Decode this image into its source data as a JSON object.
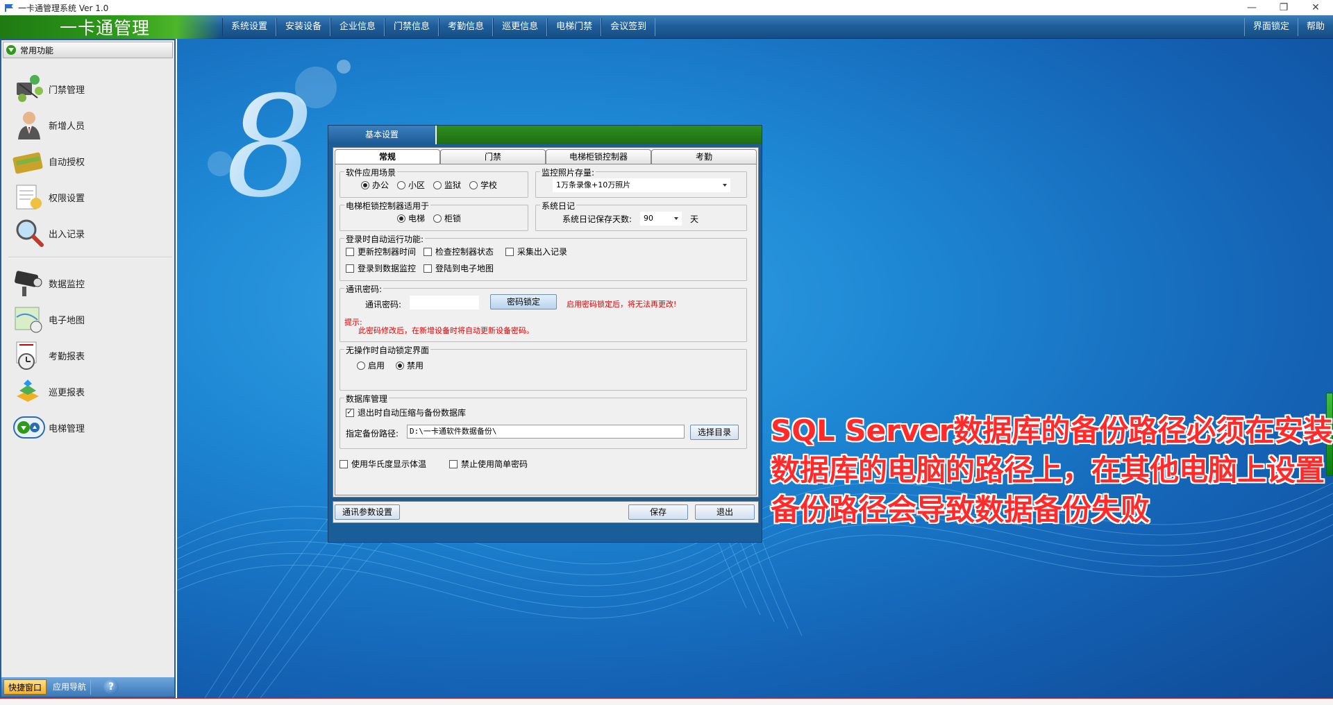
{
  "window": {
    "title": "一卡通管理系统  Ver 1.0",
    "controls": {
      "minimize": "—",
      "restore": "❐",
      "close": "✕"
    }
  },
  "header": {
    "brand": "一卡通管理",
    "menu": [
      "系统设置",
      "安装设备",
      "企业信息",
      "门禁信息",
      "考勤信息",
      "巡更信息",
      "电梯门禁",
      "会议签到"
    ],
    "right_menu": [
      "界面锁定",
      "帮助"
    ]
  },
  "sidebar": {
    "title": "常用功能",
    "items": [
      {
        "label": "门禁管理",
        "icon": "door-access-icon"
      },
      {
        "label": "新增人员",
        "icon": "person-icon"
      },
      {
        "label": "自动授权",
        "icon": "card-icon"
      },
      {
        "label": "权限设置",
        "icon": "permission-doc-icon"
      },
      {
        "label": "出入记录",
        "icon": "magnifier-icon"
      },
      {
        "label": "数据监控",
        "icon": "camera-icon"
      },
      {
        "label": "电子地图",
        "icon": "map-icon"
      },
      {
        "label": "考勤报表",
        "icon": "clock-report-icon"
      },
      {
        "label": "巡更报表",
        "icon": "patrol-icon"
      },
      {
        "label": "电梯管理",
        "icon": "elevator-icon"
      }
    ],
    "footer": {
      "tab1": "快捷窗口",
      "tab2": "应用导航",
      "help": "?"
    }
  },
  "dialog": {
    "title_tab": "基本设置",
    "tabs": [
      "常规",
      "门禁",
      "电梯柜锁控制器",
      "考勤"
    ],
    "app_scene": {
      "title": "软件应用场景",
      "options": [
        "办公",
        "小区",
        "监狱",
        "学校"
      ],
      "selected": "办公"
    },
    "photo_storage": {
      "title": "监控照片存量:",
      "value": "1万条录像+10万照片"
    },
    "controller_use": {
      "title": "电梯柜锁控制器适用于",
      "options": [
        "电梯",
        "柜锁"
      ],
      "selected": "电梯"
    },
    "syslog": {
      "title": "系统日记",
      "label": "系统日记保存天数:",
      "value": "90",
      "unit": "天"
    },
    "autorun": {
      "title": "登录时自动运行功能:",
      "options": [
        "更新控制器时间",
        "检查控制器状态",
        "采集出入记录",
        "登录到数据监控",
        "登陆到电子地图"
      ]
    },
    "comm_password": {
      "title": "通讯密码:",
      "label": "通讯密码:",
      "value": "",
      "button": "密码锁定",
      "warning": "启用密码锁定后，将无法再更改!",
      "hint_label": "提示:",
      "hint": "此密码修改后，在新增设备时将自动更新设备密码。"
    },
    "autolock": {
      "title": "无操作时自动锁定界面",
      "options": [
        "启用",
        "禁用"
      ],
      "selected": "禁用"
    },
    "database": {
      "title": "数据库管理",
      "auto_backup_label": "退出时自动压缩与备份数据库",
      "auto_backup_checked": true,
      "path_label": "指定备份路径:",
      "path_value": "D:\\一卡通软件数据备份\\",
      "browse_button": "选择目录"
    },
    "bottom_options": {
      "fahrenheit": "使用华氏度显示体温",
      "no_simple_pwd": "禁止使用简单密码"
    },
    "footer": {
      "comm_params": "通讯参数设置",
      "save": "保存",
      "exit": "退出"
    }
  },
  "overlay_caption": "SQL Server数据库的备份路径必须在安装数据库的电脑的路径上，在其他电脑上设置备份路径会导致数据备份失败",
  "colors": {
    "menu_blue": "#1f5f9c",
    "brand_green": "#2e9a1a",
    "warning_red": "#e00000",
    "caption_red": "#ff2a2a"
  }
}
